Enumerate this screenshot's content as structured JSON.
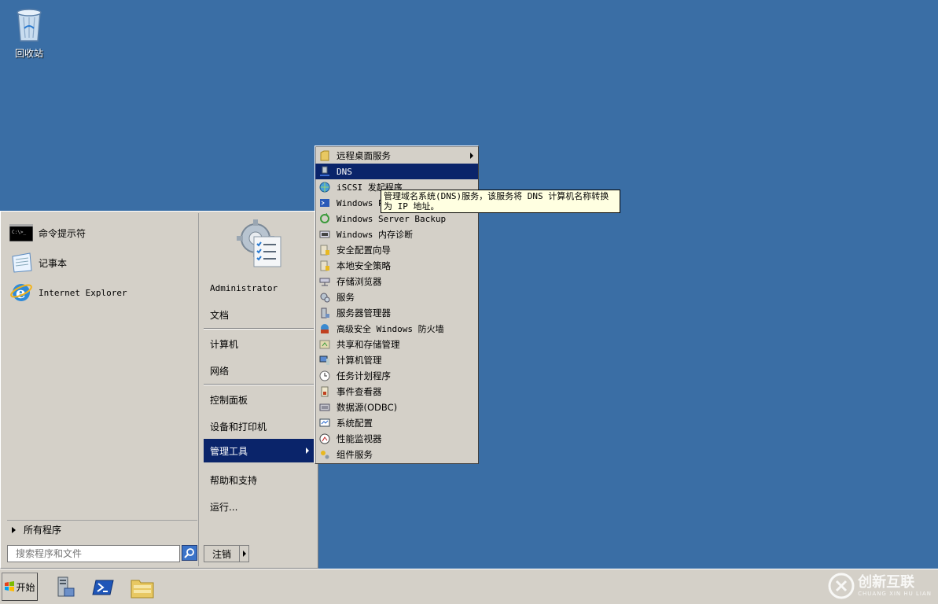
{
  "desktop": {
    "recycle_bin_label": "回收站"
  },
  "start_menu": {
    "pinned": [
      {
        "label": "命令提示符",
        "icon": "cmd-icon"
      },
      {
        "label": "记事本",
        "icon": "notepad-icon"
      },
      {
        "label": "Internet Explorer",
        "icon": "ie-icon"
      }
    ],
    "all_programs": "所有程序",
    "search_placeholder": "搜索程序和文件",
    "right": {
      "user": "Administrator",
      "documents": "文档",
      "computer": "计算机",
      "network": "网络",
      "control_panel": "控制面板",
      "devices": "设备和打印机",
      "admin_tools": "管理工具",
      "help": "帮助和支持",
      "run": "运行..."
    },
    "logoff": "注销"
  },
  "admin_submenu": {
    "items": [
      {
        "label": "远程桌面服务",
        "icon": "folder-icon",
        "has_sub": true
      },
      {
        "label": "DNS",
        "icon": "dns-icon",
        "active": true
      },
      {
        "label": "iSCSI 发起程序",
        "icon": "iscsi-icon"
      },
      {
        "label": "Windows Po",
        "icon": "powershell-icon"
      },
      {
        "label": "Windows Server Backup",
        "icon": "backup-icon"
      },
      {
        "label": "Windows 内存诊断",
        "icon": "memory-icon"
      },
      {
        "label": "安全配置向导",
        "icon": "security-wizard-icon"
      },
      {
        "label": "本地安全策略",
        "icon": "security-policy-icon"
      },
      {
        "label": "存储浏览器",
        "icon": "storage-icon"
      },
      {
        "label": "服务",
        "icon": "services-icon"
      },
      {
        "label": "服务器管理器",
        "icon": "server-manager-icon"
      },
      {
        "label": "高级安全 Windows 防火墙",
        "icon": "firewall-icon"
      },
      {
        "label": "共享和存储管理",
        "icon": "share-icon"
      },
      {
        "label": "计算机管理",
        "icon": "computer-mgmt-icon"
      },
      {
        "label": "任务计划程序",
        "icon": "clock-icon"
      },
      {
        "label": "事件查看器",
        "icon": "event-icon"
      },
      {
        "label": "数据源(ODBC)",
        "icon": "odbc-icon"
      },
      {
        "label": "系统配置",
        "icon": "msconfig-icon"
      },
      {
        "label": "性能监视器",
        "icon": "perfmon-icon"
      },
      {
        "label": "组件服务",
        "icon": "component-icon"
      }
    ]
  },
  "tooltip": {
    "line1": "管理域名系统(DNS)服务，该服务将 DNS 计算机名称转换",
    "line2": "为 IP 地址。"
  },
  "taskbar": {
    "start_label": "开始",
    "watermark": "创新互联",
    "watermark_sub": "CHUANG XIN HU LIAN"
  }
}
